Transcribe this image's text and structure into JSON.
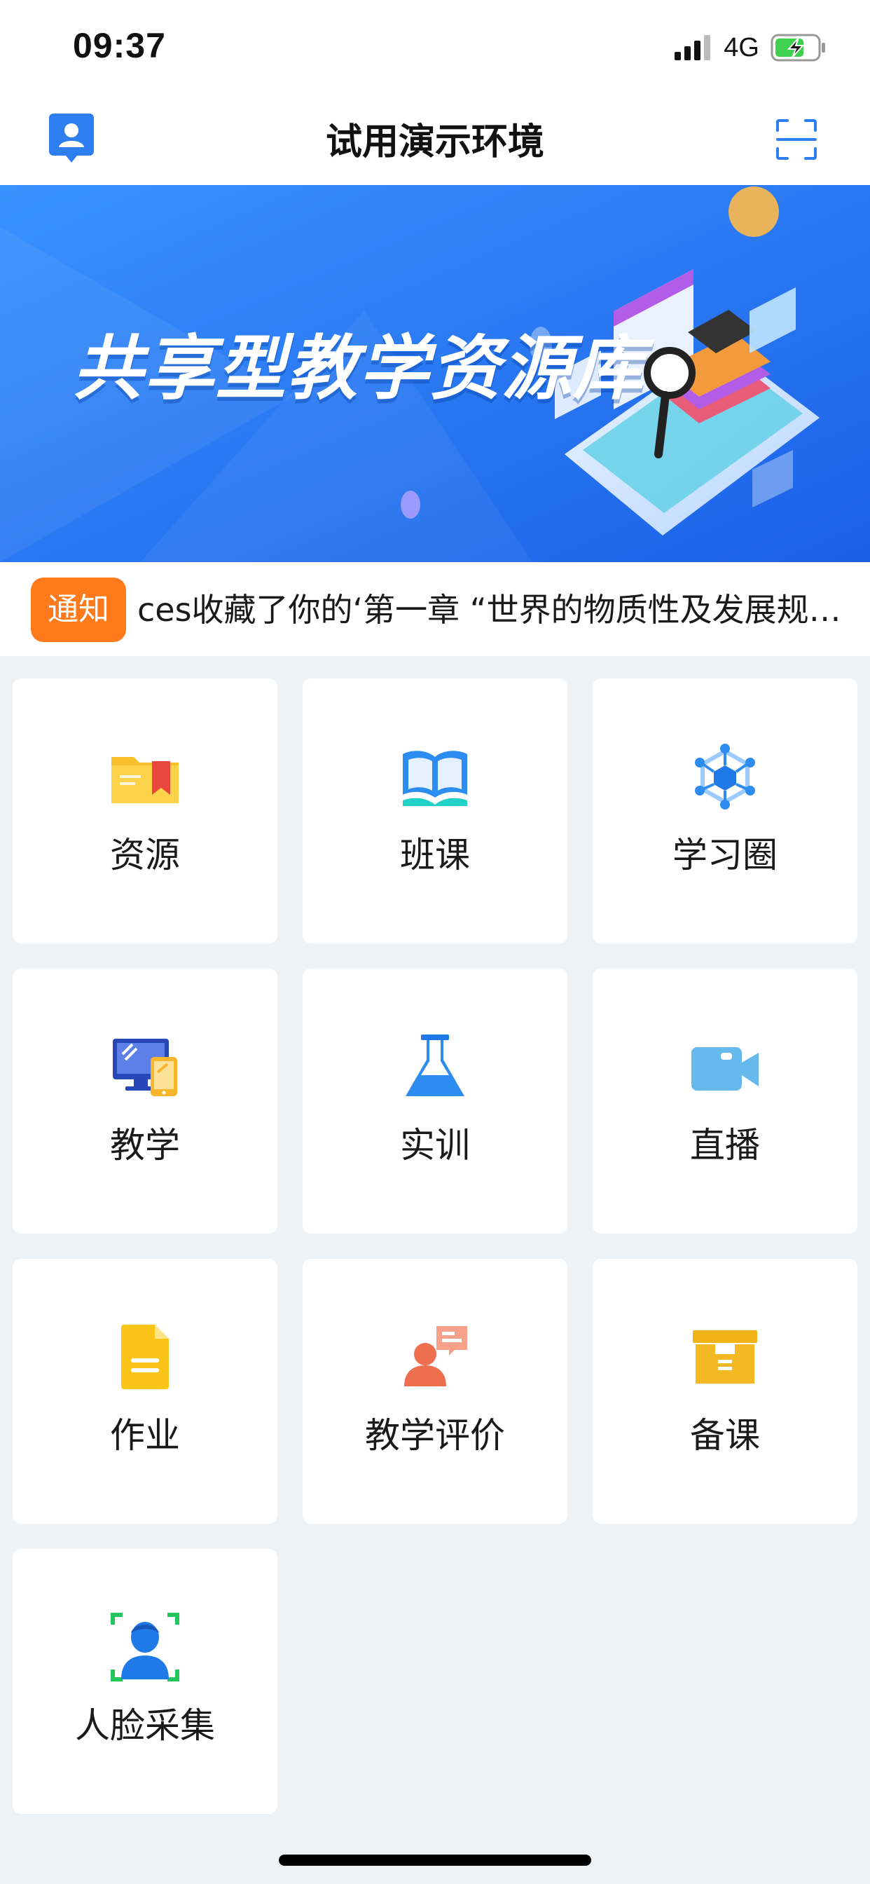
{
  "status_bar": {
    "time": "09:37",
    "network": "4G",
    "signal_icon": "signal-bars-icon",
    "battery_icon": "battery-charging-icon"
  },
  "nav": {
    "title": "试用演示环境",
    "left_icon": "user-profile-icon",
    "right_icon": "scan-icon",
    "accent_color": "#2d7ff0"
  },
  "banner": {
    "title": "共享型教学资源库",
    "gradient_start": "#2f88ff",
    "gradient_end": "#1b63e8"
  },
  "notice": {
    "badge": "通知",
    "text": "ces收藏了你的‘第一章 “世界的物质性及发展规律”’",
    "badge_color": "#ff7a1a"
  },
  "menu": {
    "items": [
      {
        "label": "资源",
        "icon": "folder-bookmark-icon"
      },
      {
        "label": "班课",
        "icon": "open-book-icon"
      },
      {
        "label": "学习圈",
        "icon": "network-hexagon-icon"
      },
      {
        "label": "教学",
        "icon": "desktop-tablet-icon"
      },
      {
        "label": "实训",
        "icon": "flask-icon"
      },
      {
        "label": "直播",
        "icon": "video-camera-icon"
      },
      {
        "label": "作业",
        "icon": "document-icon"
      },
      {
        "label": "教学评价",
        "icon": "person-comment-icon"
      },
      {
        "label": "备课",
        "icon": "archive-box-icon"
      },
      {
        "label": "人脸采集",
        "icon": "face-scan-icon"
      }
    ]
  }
}
